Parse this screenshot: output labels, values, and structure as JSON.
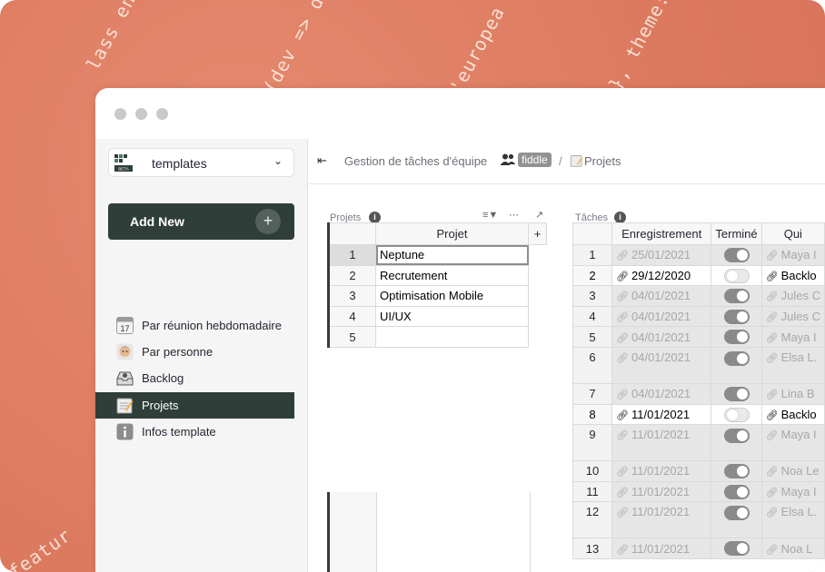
{
  "background": {
    "color": "#dc7a5f",
    "snippets": [
      "lass enhance(eurc",
      "(dev => de",
      "'europea",
      "}, theme:",
      "featur"
    ]
  },
  "sidebar": {
    "template_label": "templates",
    "logo_badge": "BETA",
    "add_new_label": "Add New",
    "add_new_icon": "+",
    "items": [
      {
        "label": "Par réunion hebdomadaire",
        "icon": "calendar-icon"
      },
      {
        "label": "Par personne",
        "icon": "person-icon"
      },
      {
        "label": "Backlog",
        "icon": "inbox-icon"
      },
      {
        "label": "Projets",
        "icon": "notepad-icon",
        "active": true
      },
      {
        "label": "Infos template",
        "icon": "info-icon"
      }
    ],
    "calendar_day": "17"
  },
  "topbar": {
    "doc_title": "Gestion de tâches d'équipe",
    "workspace": "fiddle",
    "separator": "/",
    "page": "Projets"
  },
  "projets": {
    "title": "Projets",
    "column": "Projet",
    "add_column": "+",
    "rows": [
      {
        "num": "1",
        "value": "Neptune"
      },
      {
        "num": "2",
        "value": "Recrutement"
      },
      {
        "num": "3",
        "value": "Optimisation Mobile"
      },
      {
        "num": "4",
        "value": "UI/UX"
      },
      {
        "num": "5",
        "value": ""
      }
    ]
  },
  "taches": {
    "title": "Tâches",
    "columns": [
      "Enregistrement",
      "Terminé",
      "Qui"
    ],
    "rows": [
      {
        "num": "1",
        "date": "25/01/2021",
        "done": true,
        "who": "Maya I"
      },
      {
        "num": "2",
        "date": "29/12/2020",
        "done": false,
        "who": "Backlo"
      },
      {
        "num": "3",
        "date": "04/01/2021",
        "done": true,
        "who": "Jules C"
      },
      {
        "num": "4",
        "date": "04/01/2021",
        "done": true,
        "who": "Jules C"
      },
      {
        "num": "5",
        "date": "04/01/2021",
        "done": true,
        "who": "Maya I"
      },
      {
        "num": "6",
        "date": "04/01/2021",
        "done": true,
        "who": "Elsa L."
      },
      {
        "num": "7",
        "date": "04/01/2021",
        "done": true,
        "who": "Lina B"
      },
      {
        "num": "8",
        "date": "11/01/2021",
        "done": false,
        "who": "Backlo"
      },
      {
        "num": "9",
        "date": "11/01/2021",
        "done": true,
        "who": "Maya I"
      },
      {
        "num": "10",
        "date": "11/01/2021",
        "done": true,
        "who": "Noa Le"
      },
      {
        "num": "11",
        "date": "11/01/2021",
        "done": true,
        "who": "Maya I"
      },
      {
        "num": "12",
        "date": "11/01/2021",
        "done": true,
        "who": "Elsa L."
      },
      {
        "num": "13",
        "date": "11/01/2021",
        "done": true,
        "who": "Noa L"
      }
    ]
  }
}
